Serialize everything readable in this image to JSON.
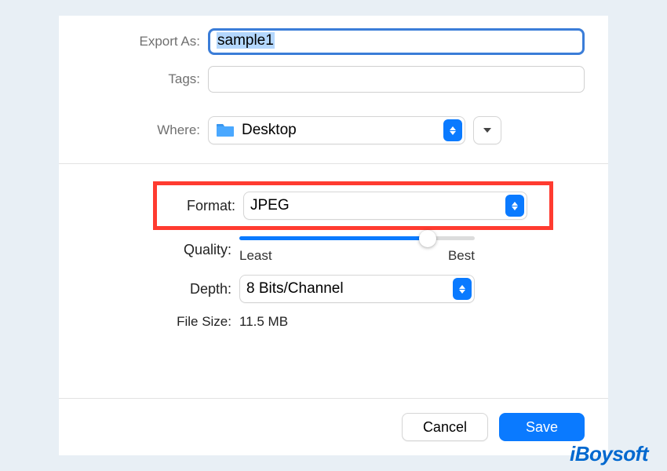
{
  "labels": {
    "export_as": "Export As:",
    "tags": "Tags:",
    "where": "Where:",
    "format": "Format:",
    "quality": "Quality:",
    "depth": "Depth:",
    "file_size": "File Size:"
  },
  "values": {
    "filename": "sample1",
    "where_location": "Desktop",
    "format": "JPEG",
    "depth": "8 Bits/Channel",
    "file_size": "11.5 MB",
    "quality_percent": 80
  },
  "slider": {
    "min_label": "Least",
    "max_label": "Best"
  },
  "buttons": {
    "cancel": "Cancel",
    "save": "Save"
  },
  "icons": {
    "folder": "folder-icon",
    "chevron": "chevron-down-icon",
    "updown": "updown-stepper-icon"
  },
  "watermark": "iBoysoft"
}
